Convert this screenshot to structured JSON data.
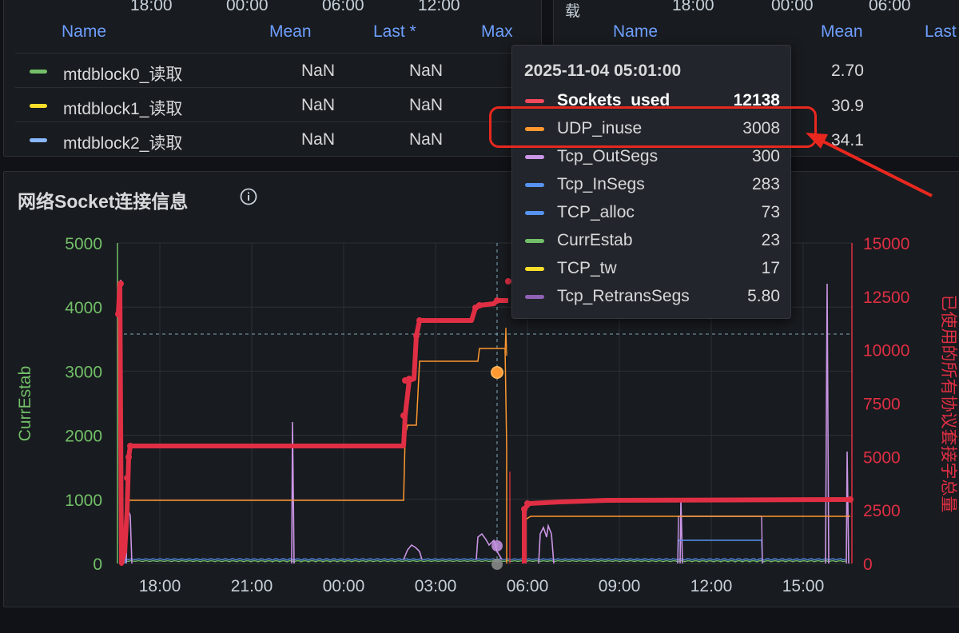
{
  "top_left": {
    "time_ticks": [
      "18:00",
      "00:00",
      "06:00",
      "12:00"
    ],
    "columns": [
      "Name",
      "Mean",
      "Last *",
      "Max"
    ],
    "rows": [
      {
        "name": "mtdblock0_读取",
        "mean": "NaN",
        "last": "NaN",
        "color": "#73bf69"
      },
      {
        "name": "mtdblock1_读取",
        "mean": "NaN",
        "last": "NaN",
        "color": "#fade2a"
      },
      {
        "name": "mtdblock2_读取",
        "mean": "NaN",
        "last": "NaN",
        "color": "#8ab8ff"
      }
    ]
  },
  "top_right": {
    "side_glyph": "载",
    "time_ticks": [
      "18:00",
      "00:00",
      "06:00"
    ],
    "columns": [
      "Name",
      "Mean",
      "Last"
    ],
    "means": [
      "2.70",
      "30.9",
      "34.1"
    ]
  },
  "panel": {
    "title": "网络Socket连接信息",
    "left_axis_label": "CurrEstab",
    "right_axis_label": "已使用的所有协议套接字总量",
    "left_ticks": [
      "5000",
      "4000",
      "3000",
      "2000",
      "1000",
      "0"
    ],
    "right_ticks": [
      "15000",
      "12500",
      "10000",
      "7500",
      "5000",
      "2500",
      "0"
    ],
    "x_ticks": [
      "18:00",
      "21:00",
      "00:00",
      "03:00",
      "06:00",
      "09:00",
      "12:00",
      "15:00"
    ]
  },
  "tooltip": {
    "time": "2025-11-04 05:01:00",
    "rows": [
      {
        "name": "Sockets_used",
        "value": "12138",
        "color": "#f2495c",
        "bold": true
      },
      {
        "name": "UDP_inuse",
        "value": "3008",
        "color": "#ff9830",
        "bold": false
      },
      {
        "name": "Tcp_OutSegs",
        "value": "300",
        "color": "#ca95e5",
        "bold": false
      },
      {
        "name": "Tcp_InSegs",
        "value": "283",
        "color": "#5794f2",
        "bold": false
      },
      {
        "name": "TCP_alloc",
        "value": "73",
        "color": "#5794f2",
        "bold": false
      },
      {
        "name": "CurrEstab",
        "value": "23",
        "color": "#73bf69",
        "bold": false
      },
      {
        "name": "TCP_tw",
        "value": "17",
        "color": "#fade2a",
        "bold": false
      },
      {
        "name": "Tcp_RetransSegs",
        "value": "5.80",
        "color": "#8f62b5",
        "bold": false
      }
    ]
  },
  "colors": {
    "sockets_used": "#e02f44",
    "udp_inuse": "#ff9830",
    "tcp_outsegs": "#ca95e5",
    "tcp_insegs": "#5794f2",
    "curr_estab": "#73bf69",
    "left_axis": "#73bf69",
    "right_axis": "#e02f44",
    "highlight": "#e8281f"
  }
}
